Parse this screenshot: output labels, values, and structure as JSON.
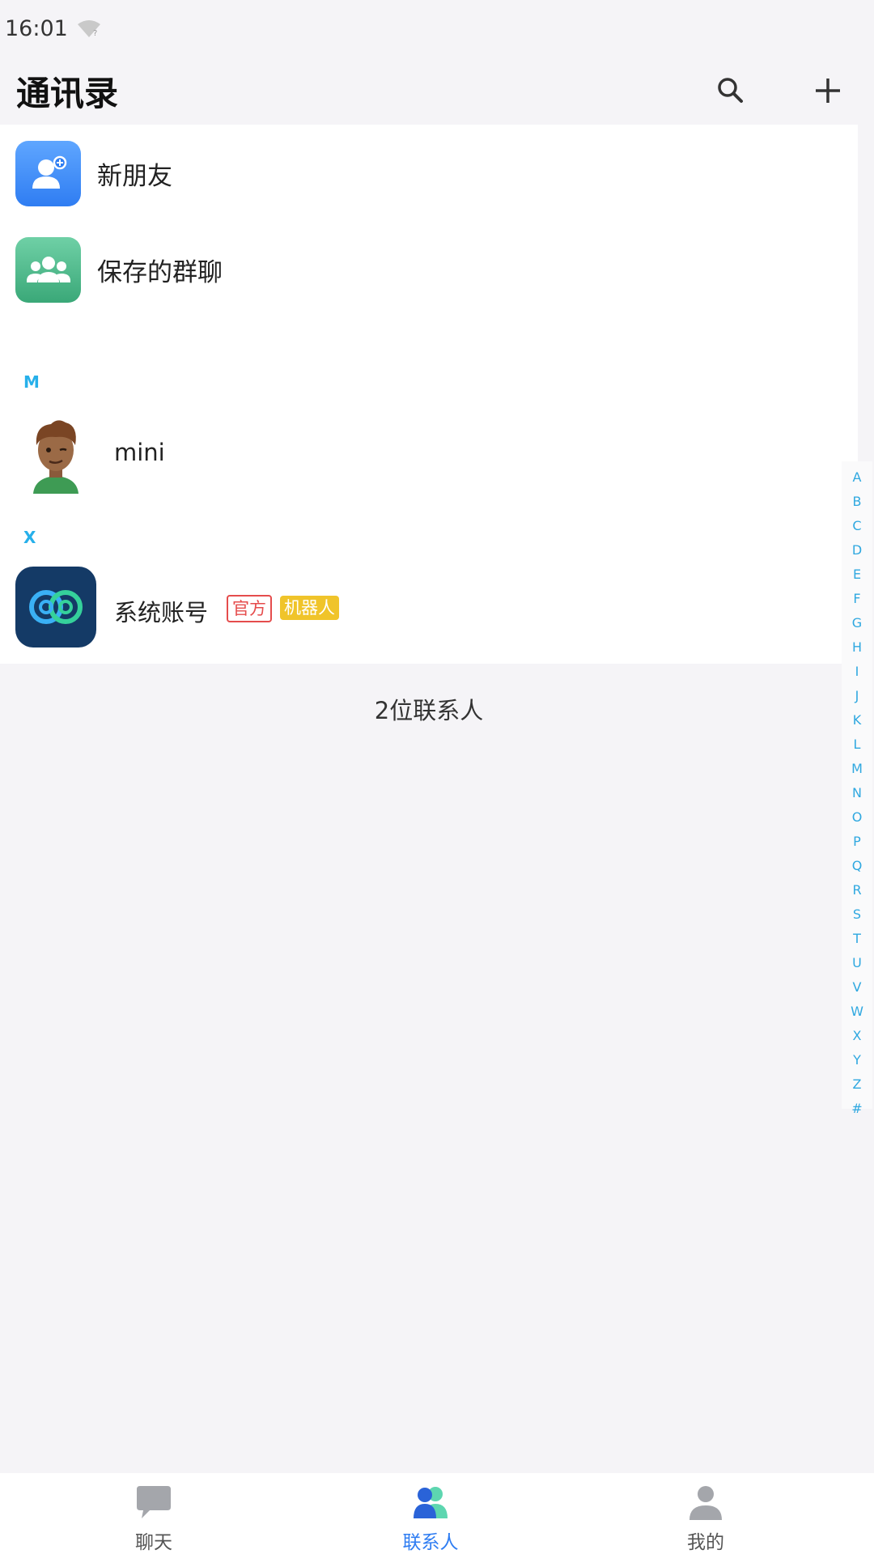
{
  "status_bar": {
    "time": "16:01"
  },
  "header": {
    "title": "通讯录"
  },
  "special_entries": [
    {
      "label": "新朋友",
      "icon": "add-friend-icon",
      "color": "#3d8ff7"
    },
    {
      "label": "保存的群聊",
      "icon": "group-icon",
      "color": "#4fbb8b"
    }
  ],
  "sections": [
    {
      "letter": "M",
      "contacts": [
        {
          "name": "mini",
          "avatar": "cartoon-man-avatar"
        }
      ]
    },
    {
      "letter": "X",
      "contacts": [
        {
          "name": "系统账号",
          "avatar": "system-logo-avatar",
          "tags": [
            "官方",
            "机器人"
          ]
        }
      ]
    }
  ],
  "contact_count": "2位联系人",
  "alpha_index": [
    "A",
    "B",
    "C",
    "D",
    "E",
    "F",
    "G",
    "H",
    "I",
    "J",
    "K",
    "L",
    "M",
    "N",
    "O",
    "P",
    "Q",
    "R",
    "S",
    "T",
    "U",
    "V",
    "W",
    "X",
    "Y",
    "Z",
    "#"
  ],
  "tabs": [
    {
      "label": "聊天",
      "icon": "chat-bubble-icon",
      "active": false
    },
    {
      "label": "联系人",
      "icon": "contacts-icon",
      "active": true
    },
    {
      "label": "我的",
      "icon": "profile-icon",
      "active": false
    }
  ],
  "colors": {
    "accent": "#2f7df2",
    "section_letter": "#27b0ea",
    "tag_official": "#e54c4c",
    "tag_robot": "#f0c42a"
  }
}
